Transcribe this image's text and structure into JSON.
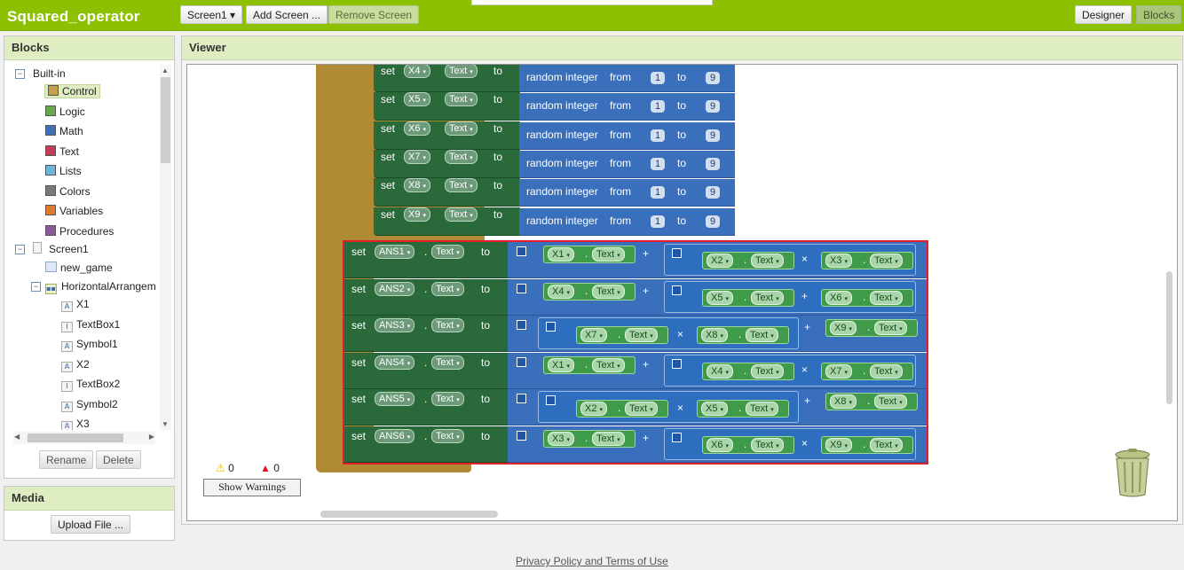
{
  "app": {
    "title": "Squared_operator"
  },
  "toolbar": {
    "screen": "Screen1 ▾",
    "add_screen": "Add Screen ...",
    "remove_screen": "Remove Screen",
    "designer": "Designer",
    "blocks": "Blocks"
  },
  "blocks_panel": {
    "title": "Blocks",
    "builtin_label": "Built-in",
    "builtin": [
      {
        "label": "Control",
        "color": "#c4a14a"
      },
      {
        "label": "Logic",
        "color": "#6aa84f"
      },
      {
        "label": "Math",
        "color": "#3f6fb5"
      },
      {
        "label": "Text",
        "color": "#c43a5b"
      },
      {
        "label": "Lists",
        "color": "#6bb5d8"
      },
      {
        "label": "Colors",
        "color": "#7a7a7a"
      },
      {
        "label": "Variables",
        "color": "#e07b2e"
      },
      {
        "label": "Procedures",
        "color": "#8a5a9a"
      }
    ],
    "screen_label": "Screen1",
    "components": [
      {
        "label": "new_game",
        "icon": "button"
      },
      {
        "label": "HorizontalArrangem",
        "icon": "arrangement"
      }
    ],
    "children": [
      {
        "label": "X1",
        "icon": "A"
      },
      {
        "label": "TextBox1",
        "icon": "I"
      },
      {
        "label": "Symbol1",
        "icon": "A"
      },
      {
        "label": "X2",
        "icon": "A"
      },
      {
        "label": "TextBox2",
        "icon": "I"
      },
      {
        "label": "Symbol2",
        "icon": "A"
      },
      {
        "label": "X3",
        "icon": "A"
      }
    ],
    "rename": "Rename",
    "delete": "Delete"
  },
  "media": {
    "title": "Media",
    "upload": "Upload File ..."
  },
  "viewer": {
    "title": "Viewer",
    "random_rows": [
      {
        "var": "X4",
        "prop": "Text",
        "set": "set",
        "to": "to",
        "fn": "random integer",
        "from": "from",
        "lo": "1",
        "to2": "to",
        "hi": "9"
      },
      {
        "var": "X5",
        "prop": "Text",
        "set": "set",
        "to": "to",
        "fn": "random integer",
        "from": "from",
        "lo": "1",
        "to2": "to",
        "hi": "9"
      },
      {
        "var": "X6",
        "prop": "Text",
        "set": "set",
        "to": "to",
        "fn": "random integer",
        "from": "from",
        "lo": "1",
        "to2": "to",
        "hi": "9"
      },
      {
        "var": "X7",
        "prop": "Text",
        "set": "set",
        "to": "to",
        "fn": "random integer",
        "from": "from",
        "lo": "1",
        "to2": "to",
        "hi": "9"
      },
      {
        "var": "X8",
        "prop": "Text",
        "set": "set",
        "to": "to",
        "fn": "random integer",
        "from": "from",
        "lo": "1",
        "to2": "to",
        "hi": "9"
      },
      {
        "var": "X9",
        "prop": "Text",
        "set": "set",
        "to": "to",
        "fn": "random integer",
        "from": "from",
        "lo": "1",
        "to2": "to",
        "hi": "9"
      }
    ],
    "ans_rows": [
      {
        "var": "ANS1",
        "prop": "Text",
        "form": "a+bc",
        "a": "X1",
        "op1": "+",
        "b": "X2",
        "op2": "×",
        "c": "X3"
      },
      {
        "var": "ANS2",
        "prop": "Text",
        "form": "a+bc",
        "a": "X4",
        "op1": "+",
        "b": "X5",
        "op2": "+",
        "c": "X6"
      },
      {
        "var": "ANS3",
        "prop": "Text",
        "form": "ab+c",
        "a": "X7",
        "op1": "×",
        "b": "X8",
        "op2": "+",
        "c": "X9"
      },
      {
        "var": "ANS4",
        "prop": "Text",
        "form": "a+bc",
        "a": "X1",
        "op1": "+",
        "b": "X4",
        "op2": "×",
        "c": "X7"
      },
      {
        "var": "ANS5",
        "prop": "Text",
        "form": "ab+c",
        "a": "X2",
        "op1": "×",
        "b": "X5",
        "op2": "+",
        "c": "X8"
      },
      {
        "var": "ANS6",
        "prop": "Text",
        "form": "a+bc",
        "a": "X3",
        "op1": "+",
        "b": "X6",
        "op2": "×",
        "c": "X9"
      }
    ],
    "warnings": "0",
    "errors": "0",
    "show_warnings": "Show Warnings"
  },
  "footer": {
    "privacy": "Privacy Policy and Terms of Use"
  }
}
